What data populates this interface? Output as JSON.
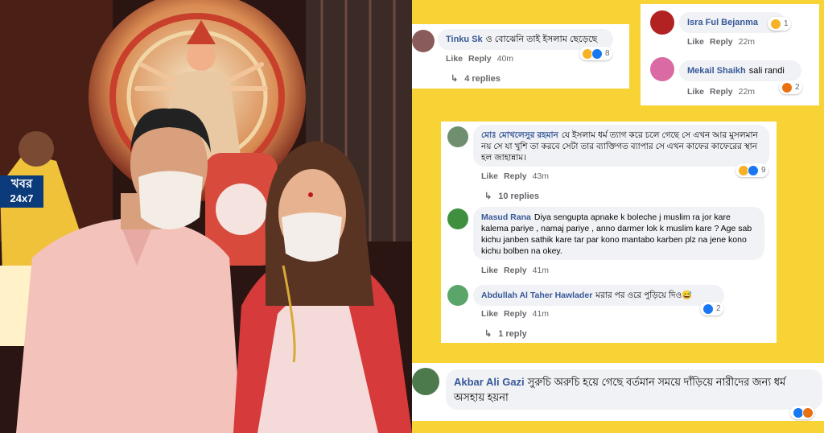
{
  "logo": {
    "line1": "খবর",
    "line2": "24x7"
  },
  "colors": {
    "accent_yellow": "#f7d336",
    "fb_blue": "#385898",
    "fb_gray": "#65676b",
    "bubble_bg": "#f0f2f5"
  },
  "comments": [
    {
      "id": "tinku",
      "name": "Tinku Sk",
      "text": "ও বোঝেনি তাই ইসলাম ছেড়েছে",
      "like": "Like",
      "reply": "Reply",
      "time": "40m",
      "reactions": "8",
      "replies": "4 replies"
    },
    {
      "id": "isra",
      "name": "Isra Ful Bejanma",
      "text": "",
      "like": "Like",
      "reply": "Reply",
      "time": "22m",
      "reactions": "1"
    },
    {
      "id": "mekail",
      "name": "Mekail Shaikh",
      "text": "sali randi",
      "like": "Like",
      "reply": "Reply",
      "time": "22m",
      "reactions": "2"
    },
    {
      "id": "mokhles",
      "name": "মোঃ মোখলেসুর রহমান",
      "text": "যে ইসলাম ধর্ম ত্যাগ করে চলে গেছে সে এখন আর মুসলমান নয় সে যা খুশি তা করবে সেটা তার ব্যাক্তিগত ব্যাপার সে এখন কাফের কাফেরের স্থান হল জাহান্নাম।",
      "like": "Like",
      "reply": "Reply",
      "time": "43m",
      "reactions": "9",
      "replies": "10 replies"
    },
    {
      "id": "masud",
      "name": "Masud Rana",
      "text": "Diya sengupta apnake k boleche j muslim ra jor kare kalema pariye , namaj pariye , anno darmer lok k muslim kare ? Age sab kichu janben sathik kare tar par kono mantabo karben plz na jene kono kichu bolben na okey.",
      "like": "Like",
      "reply": "Reply",
      "time": "41m"
    },
    {
      "id": "abdullah",
      "name": "Abdullah Al Taher Hawlader",
      "text": "মরার পর ওরে পুড়িয়ে দিও😅",
      "like": "Like",
      "reply": "Reply",
      "time": "41m",
      "reactions": "2",
      "replies": "1 reply"
    },
    {
      "id": "akbar",
      "name": "Akbar Ali Gazi",
      "text": "সুরুচি অরুচি হয়ে গেছে বর্তমান সময়ে দাঁড়িয়ে নারীদের জন্য ধর্ম অসহায় হয়না"
    }
  ]
}
